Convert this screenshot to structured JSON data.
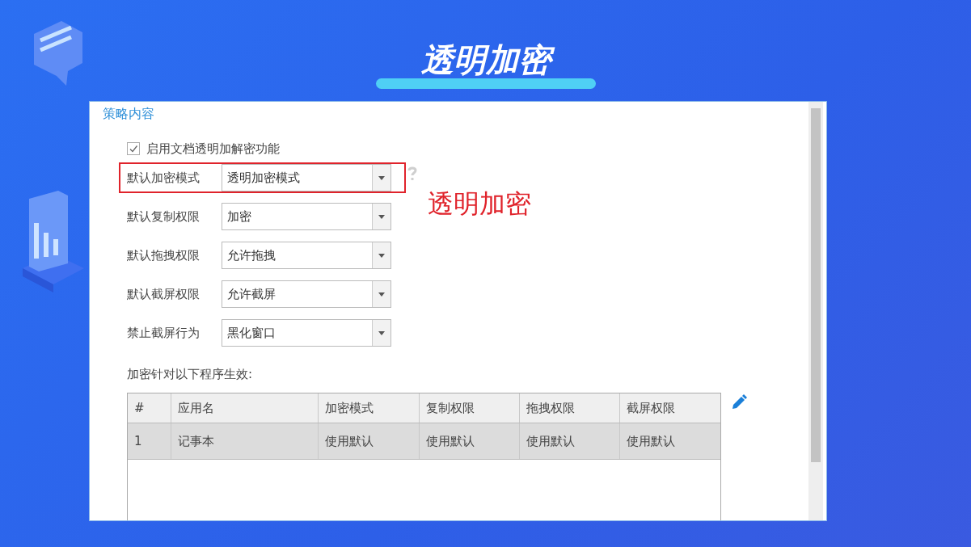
{
  "slide": {
    "title": "透明加密"
  },
  "panel": {
    "heading": "策略内容",
    "enable": {
      "label": "启用文档透明加解密功能",
      "checked": true
    },
    "fields": [
      {
        "label": "默认加密模式",
        "value": "透明加密模式",
        "highlighted": true,
        "help": true
      },
      {
        "label": "默认复制权限",
        "value": "加密",
        "highlighted": false,
        "help": false
      },
      {
        "label": "默认拖拽权限",
        "value": "允许拖拽",
        "highlighted": false,
        "help": false
      },
      {
        "label": "默认截屏权限",
        "value": "允许截屏",
        "highlighted": false,
        "help": false
      },
      {
        "label": "禁止截屏行为",
        "value": "黑化窗口",
        "highlighted": false,
        "help": false
      }
    ],
    "callout": "透明加密",
    "table_caption": "加密针对以下程序生效:",
    "table": {
      "columns": [
        "#",
        "应用名",
        "加密模式",
        "复制权限",
        "拖拽权限",
        "截屏权限"
      ],
      "rows": [
        {
          "cells": [
            "1",
            "记事本",
            "使用默认",
            "使用默认",
            "使用默认",
            "使用默认"
          ],
          "selected": true
        }
      ]
    }
  }
}
